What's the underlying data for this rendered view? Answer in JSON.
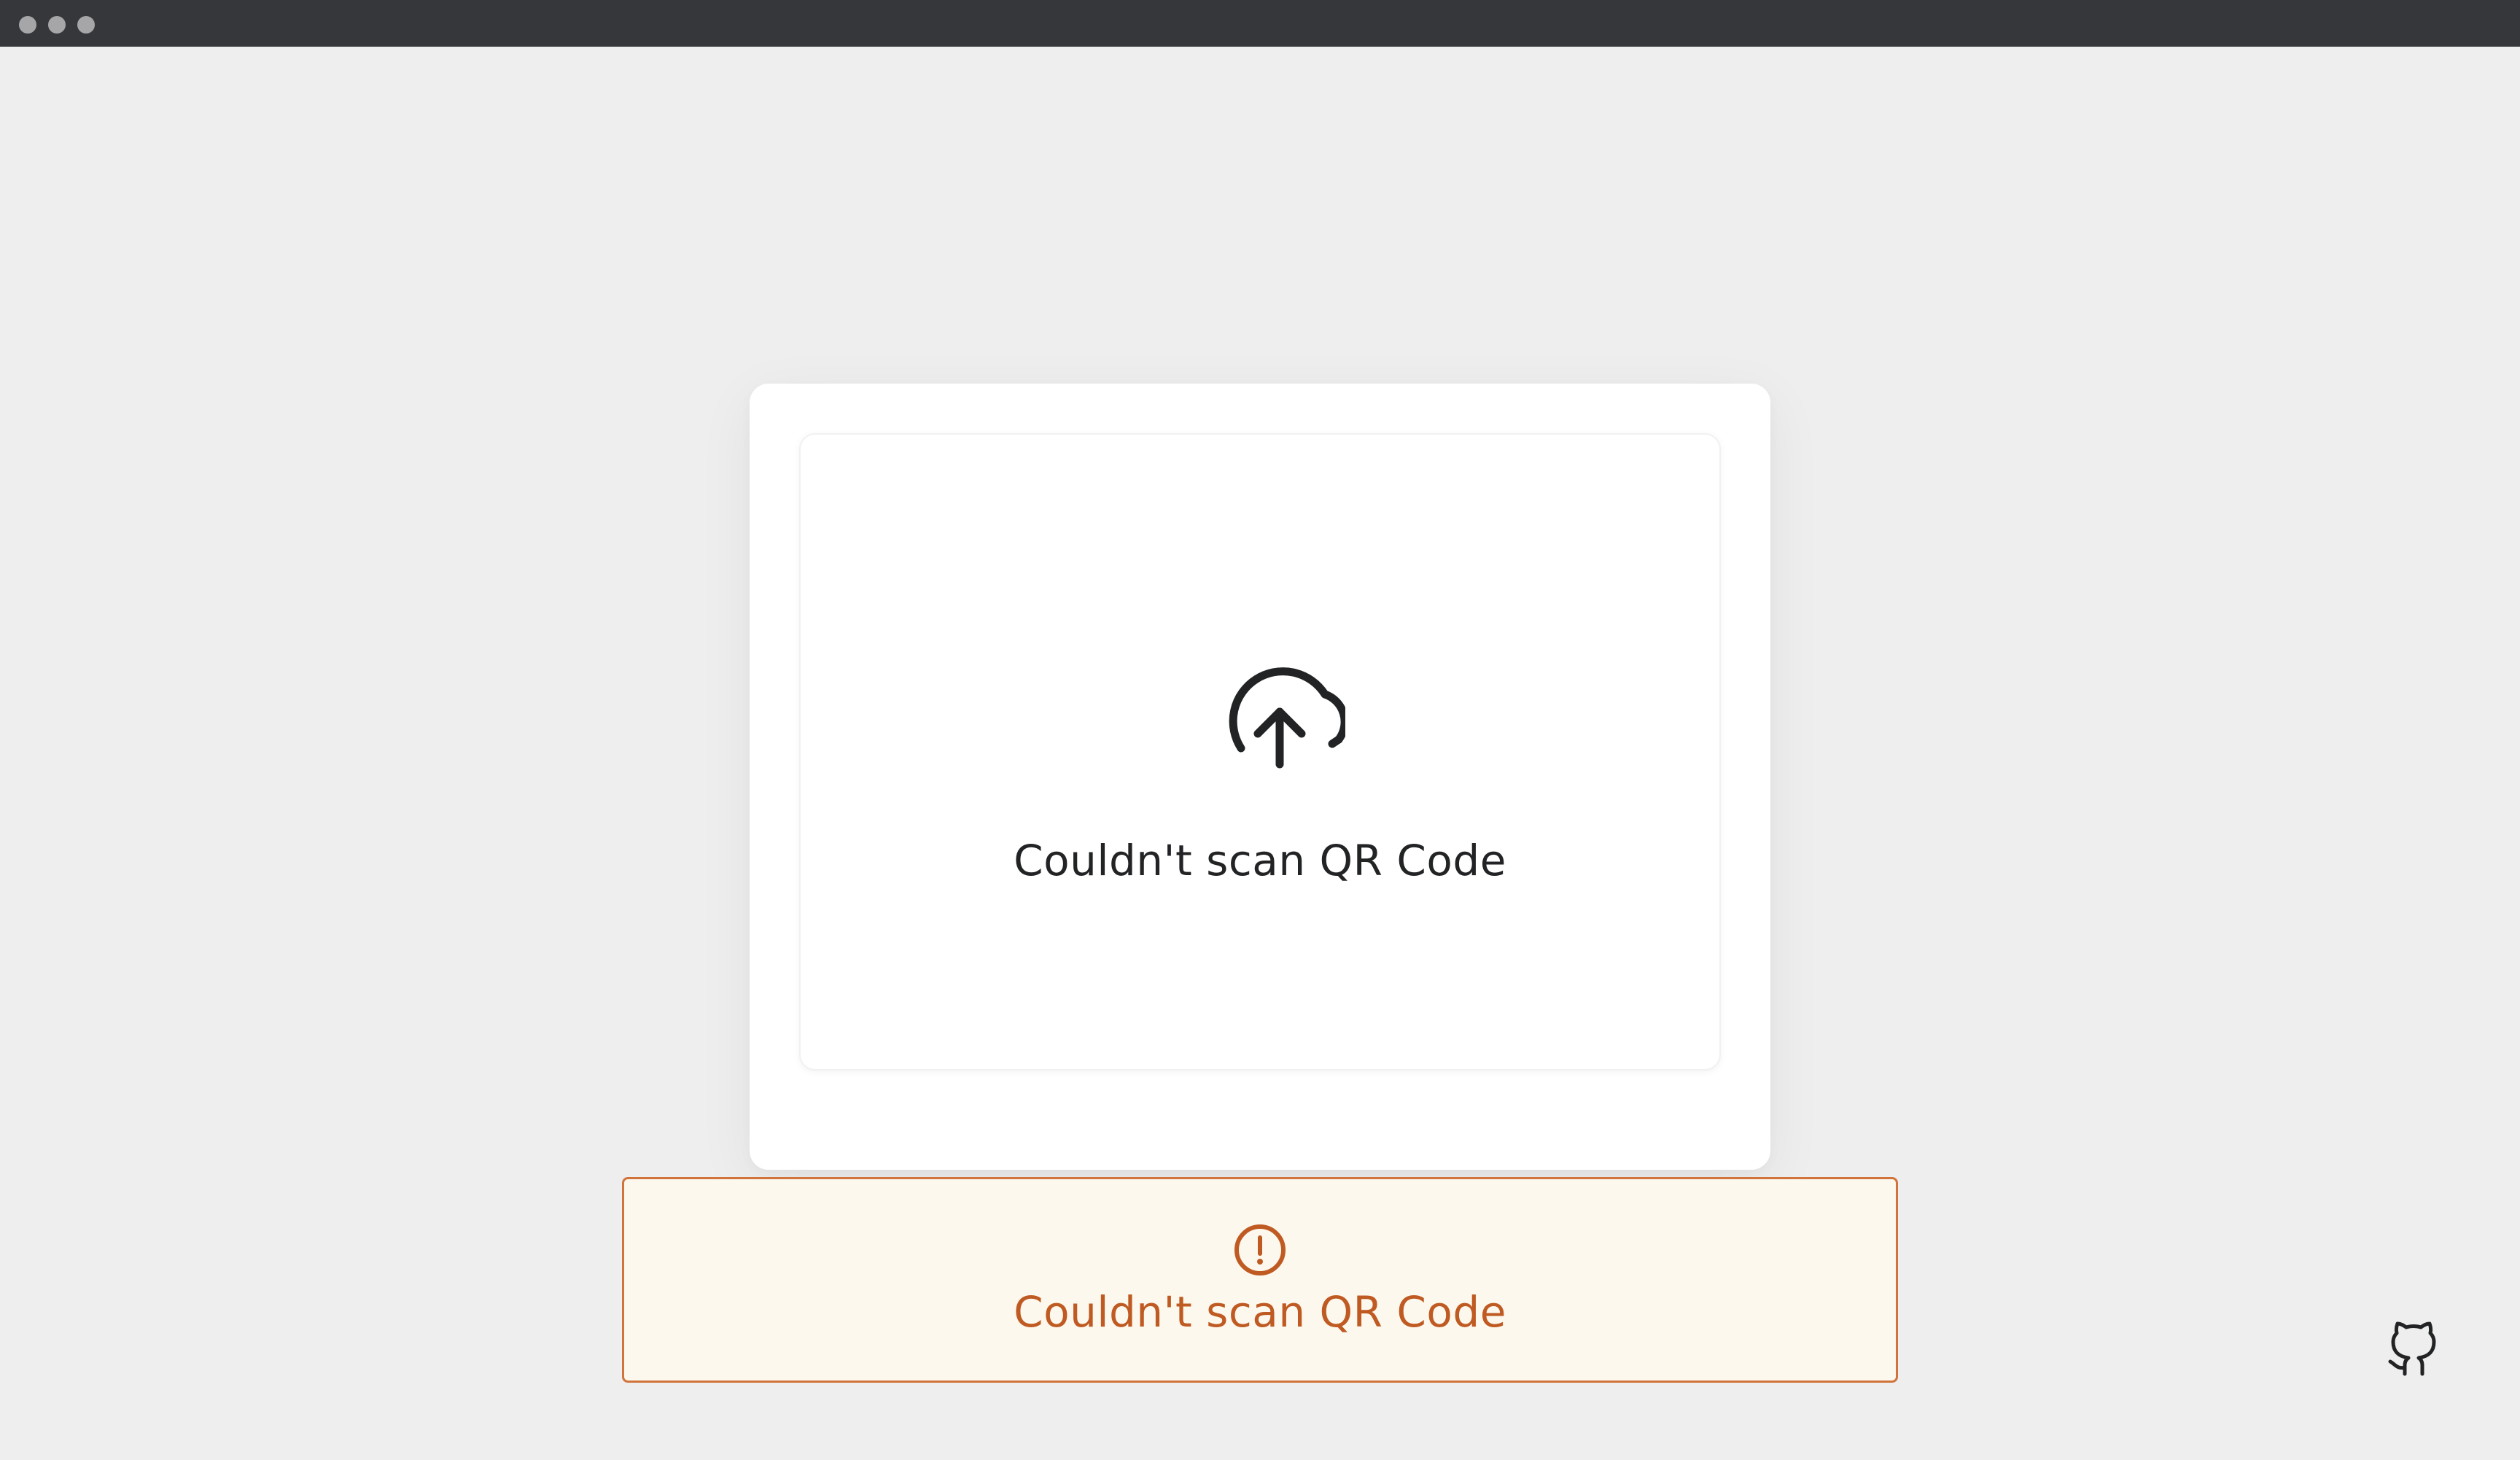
{
  "window": {
    "controls": [
      "close",
      "minimize",
      "maximize"
    ]
  },
  "dropzone": {
    "icon": "cloud-upload-icon",
    "message": "Couldn't scan QR Code"
  },
  "error": {
    "icon": "alert-circle-icon",
    "message": "Couldn't scan QR Code",
    "color": "#bf5b22",
    "border_color": "#d0743c",
    "background": "#fdf8ee"
  },
  "footer": {
    "github_icon": "github-icon"
  }
}
